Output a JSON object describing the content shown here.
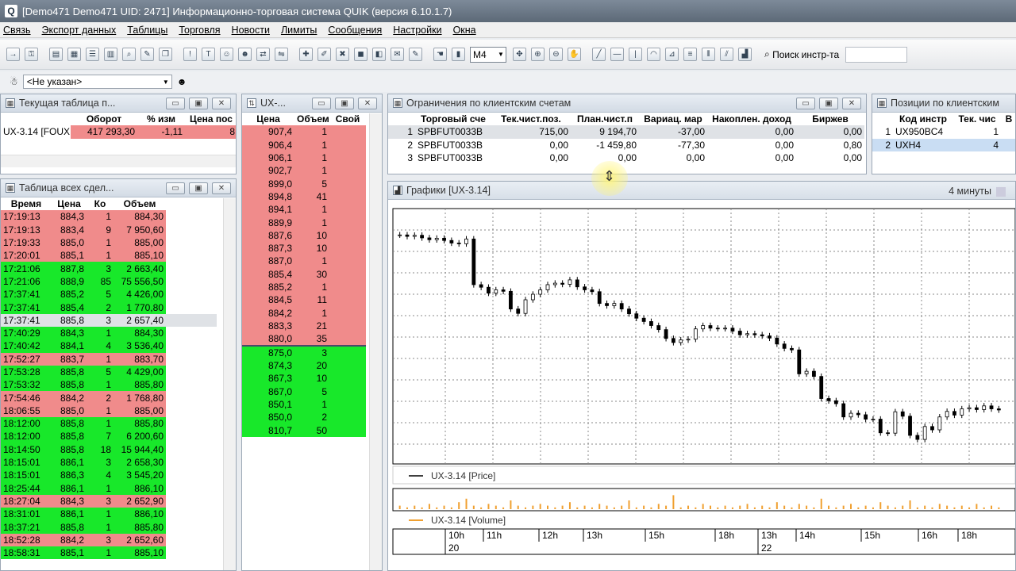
{
  "window": {
    "title": "[Demo471 Demo471  UID: 2471] Информационно-торговая система QUIK (версия 6.10.1.7)",
    "icon_letter": "Q"
  },
  "menu": [
    "Связь",
    "Экспорт данных",
    "Таблицы",
    "Торговля",
    "Новости",
    "Лимиты",
    "Сообщения",
    "Настройки",
    "Окна"
  ],
  "toolbar": {
    "interval": "M4",
    "search_label": "Поиск инстр-та",
    "search_placeholder": ""
  },
  "clientbar": {
    "client_value": "<Не указан>"
  },
  "current_table": {
    "title": "Текущая таблица п...",
    "columns": [
      "",
      "Оборот",
      "% изм",
      "Цена пос"
    ],
    "rows": [
      [
        "UX-3.14 [FOUX",
        "417 293,30",
        "-1,11",
        "8"
      ]
    ]
  },
  "deals_table": {
    "title": "Таблица всех сдел...",
    "columns": [
      "Время",
      "Цена",
      "Ко",
      "Объем"
    ],
    "rows": [
      [
        "17:19:13",
        "884,3",
        "1",
        "884,30",
        "red"
      ],
      [
        "17:19:13",
        "883,4",
        "9",
        "7 950,60",
        "red"
      ],
      [
        "17:19:33",
        "885,0",
        "1",
        "885,00",
        "red"
      ],
      [
        "17:20:01",
        "885,1",
        "1",
        "885,10",
        "red"
      ],
      [
        "17:21:06",
        "887,8",
        "3",
        "2 663,40",
        "grn"
      ],
      [
        "17:21:06",
        "888,9",
        "85",
        "75 556,50",
        "grn"
      ],
      [
        "17:37:41",
        "885,2",
        "5",
        "4 426,00",
        "grn"
      ],
      [
        "17:37:41",
        "885,4",
        "2",
        "1 770,80",
        "grn"
      ],
      [
        "17:37:41",
        "885,8",
        "3",
        "2 657,40",
        "hl"
      ],
      [
        "17:40:29",
        "884,3",
        "1",
        "884,30",
        "grn"
      ],
      [
        "17:40:42",
        "884,1",
        "4",
        "3 536,40",
        "grn"
      ],
      [
        "17:52:27",
        "883,7",
        "1",
        "883,70",
        "red"
      ],
      [
        "17:53:28",
        "885,8",
        "5",
        "4 429,00",
        "grn"
      ],
      [
        "17:53:32",
        "885,8",
        "1",
        "885,80",
        "grn"
      ],
      [
        "17:54:46",
        "884,2",
        "2",
        "1 768,80",
        "red"
      ],
      [
        "18:06:55",
        "885,0",
        "1",
        "885,00",
        "red"
      ],
      [
        "18:12:00",
        "885,8",
        "1",
        "885,80",
        "grn"
      ],
      [
        "18:12:00",
        "885,8",
        "7",
        "6 200,60",
        "grn"
      ],
      [
        "18:14:50",
        "885,8",
        "18",
        "15 944,40",
        "grn"
      ],
      [
        "18:15:01",
        "886,1",
        "3",
        "2 658,30",
        "grn"
      ],
      [
        "18:15:01",
        "886,3",
        "4",
        "3 545,20",
        "grn"
      ],
      [
        "18:25:44",
        "886,1",
        "1",
        "886,10",
        "grn"
      ],
      [
        "18:27:04",
        "884,3",
        "3",
        "2 652,90",
        "red"
      ],
      [
        "18:31:01",
        "886,1",
        "1",
        "886,10",
        "grn"
      ],
      [
        "18:37:21",
        "885,8",
        "1",
        "885,80",
        "grn"
      ],
      [
        "18:52:28",
        "884,2",
        "3",
        "2 652,60",
        "red"
      ],
      [
        "18:58:31",
        "885,1",
        "1",
        "885,10",
        "grn"
      ]
    ]
  },
  "orderbook": {
    "title": "UX-...",
    "columns": [
      "Цена",
      "Объем",
      "Свой"
    ],
    "asks": [
      [
        "907,4",
        "1"
      ],
      [
        "906,4",
        "1"
      ],
      [
        "906,1",
        "1"
      ],
      [
        "902,7",
        "1"
      ],
      [
        "899,0",
        "5"
      ],
      [
        "894,8",
        "41"
      ],
      [
        "894,1",
        "1"
      ],
      [
        "889,9",
        "1"
      ],
      [
        "887,6",
        "10"
      ],
      [
        "887,3",
        "10"
      ],
      [
        "887,0",
        "1"
      ],
      [
        "885,4",
        "30"
      ],
      [
        "885,2",
        "1"
      ],
      [
        "884,5",
        "11"
      ],
      [
        "884,2",
        "1"
      ],
      [
        "883,3",
        "21"
      ],
      [
        "880,0",
        "35"
      ]
    ],
    "bids": [
      [
        "875,0",
        "3"
      ],
      [
        "874,3",
        "20"
      ],
      [
        "867,3",
        "10"
      ],
      [
        "867,0",
        "5"
      ],
      [
        "850,1",
        "1"
      ],
      [
        "850,0",
        "2"
      ],
      [
        "810,7",
        "50"
      ]
    ]
  },
  "limits": {
    "title": "Ограничения по клиентским счетам",
    "columns": [
      "",
      "Торговый сче",
      "Тек.чист.поз.",
      "План.чист.п",
      "Вариац. мар",
      "Накоплен. доход",
      "Биржев"
    ],
    "rows": [
      [
        "1",
        "SPBFUT0033B",
        "715,00",
        "9 194,70",
        "-37,00",
        "0,00",
        "0,00"
      ],
      [
        "2",
        "SPBFUT0033B",
        "0,00",
        "-1 459,80",
        "-77,30",
        "0,00",
        "0,80"
      ],
      [
        "3",
        "SPBFUT0033B",
        "0,00",
        "0,00",
        "0,00",
        "0,00",
        "0,00"
      ]
    ]
  },
  "positions": {
    "title": "Позиции по клиентским",
    "columns": [
      "",
      "Код инстр",
      "Тек. чис",
      "В"
    ],
    "rows": [
      [
        "1",
        "UX950BC4",
        "1"
      ],
      [
        "2",
        "UXH4",
        "4"
      ]
    ]
  },
  "chart": {
    "title": "Графики [UX-3.14]",
    "timeframe": "4 минуты",
    "price_legend": "UX-3.14 [Price]",
    "volume_legend": "UX-3.14 [Volume]",
    "hours": [
      "10h",
      "11h",
      "12h",
      "13h",
      "15h",
      "18h",
      "13h",
      "14h",
      "15h",
      "16h",
      "18h"
    ],
    "dates": [
      "20",
      "22"
    ],
    "colors": {
      "candle": "#000000",
      "volume": "#f0a030"
    }
  },
  "chart_data": {
    "type": "candlestick",
    "title": "",
    "series": [
      {
        "name": "UX-3.14 [Price]",
        "values": [
          895.0,
          894.6,
          894.9,
          894.2,
          893.7,
          894.1,
          893.5,
          892.8,
          892.6,
          893.9,
          881.5,
          880.8,
          879.2,
          880.1,
          879.7,
          874.9,
          873.7,
          877.4,
          878.9,
          880.1,
          881.5,
          881.9,
          881.6,
          882.8,
          880.9,
          880.1,
          879.6,
          876.4,
          875.8,
          876.4,
          874.9,
          873.6,
          872.4,
          871.5,
          870.4,
          869.3,
          866.9,
          865.8,
          866.5,
          866.7,
          869.5,
          870.4,
          869.7,
          869.6,
          869.7,
          868.9,
          867.9,
          868.2,
          867.9,
          867.6,
          867.0,
          865.4,
          864.2,
          863.8,
          857.3,
          858.0,
          856.6,
          850.6,
          850.0,
          849.2,
          845.6,
          846.6,
          846.2,
          845.0,
          845.0,
          841.3,
          841.2,
          847.0,
          845.8,
          840.6,
          839.5,
          843.0,
          842.1,
          845.6,
          847.1,
          846.1,
          847.8,
          848.1,
          847.6,
          848.6,
          847.8,
          847.5
        ]
      },
      {
        "name": "UX-3.14 [Volume]",
        "values": [
          2,
          1,
          2,
          1,
          3,
          1,
          2,
          1,
          4,
          6,
          2,
          1,
          3,
          2,
          1,
          5,
          2,
          1,
          2,
          3,
          2,
          1,
          2,
          4,
          1,
          2,
          1,
          3,
          2,
          1,
          2,
          5,
          1,
          2,
          1,
          3,
          2,
          8,
          1,
          2,
          1,
          3,
          2,
          1,
          2,
          1,
          2,
          3,
          1,
          2,
          1,
          4,
          2,
          1,
          3,
          2,
          1,
          6,
          2,
          1,
          2,
          3,
          1,
          2,
          1,
          4,
          2,
          1,
          2,
          5,
          1,
          2,
          1,
          3,
          2,
          1,
          2,
          1,
          3,
          1,
          2,
          1
        ]
      }
    ]
  }
}
